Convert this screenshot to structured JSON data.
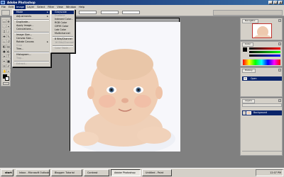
{
  "window": {
    "title": "Adobe Photoshop",
    "minimize": "_",
    "maximize": "□",
    "close": "×"
  },
  "menubar": {
    "items": [
      "File",
      "Edit",
      "Image",
      "Layer",
      "Select",
      "Filter",
      "View",
      "Window",
      "Help"
    ]
  },
  "image_menu": {
    "items": [
      {
        "label": "Mode",
        "state": "highlighted",
        "submenu": true
      },
      {
        "label": "Adjustments",
        "state": "normal",
        "submenu": true
      },
      {
        "label": "Duplicate...",
        "state": "normal"
      },
      {
        "label": "Apply Image...",
        "state": "normal"
      },
      {
        "label": "Calculations...",
        "state": "normal"
      },
      {
        "label": "Image Size...",
        "state": "normal"
      },
      {
        "label": "Canvas Size...",
        "state": "normal"
      },
      {
        "label": "Rotate Canvas",
        "state": "normal",
        "submenu": true
      },
      {
        "label": "Crop",
        "state": "disabled"
      },
      {
        "label": "Trim...",
        "state": "normal"
      },
      {
        "label": "Histogram...",
        "state": "normal"
      },
      {
        "label": "Trap...",
        "state": "disabled"
      },
      {
        "label": "Extract...",
        "state": "disabled"
      },
      {
        "label": "Liquify...",
        "state": "normal"
      }
    ]
  },
  "mode_submenu": {
    "items": [
      {
        "label": "Grayscale",
        "state": "highlighted"
      },
      {
        "label": "Duotone",
        "state": "disabled"
      },
      {
        "label": "Indexed Color...",
        "state": "normal"
      },
      {
        "label": "RGB Color",
        "state": "normal"
      },
      {
        "label": "CMYK Color",
        "state": "normal"
      },
      {
        "label": "Lab Color",
        "state": "normal"
      },
      {
        "label": "Multichannel",
        "state": "normal"
      },
      {
        "label": "8 Bits/Channel",
        "state": "normal"
      },
      {
        "label": "16 Bits/Channel",
        "state": "disabled"
      },
      {
        "label": "Color Table...",
        "state": "disabled"
      }
    ]
  },
  "panels": {
    "navigator_tab": "Navigator",
    "color_tab": "Color",
    "history_tab": "History",
    "history_item": "Open",
    "layers_tab": "Layers",
    "layer_name": "Background"
  },
  "taskbar": {
    "start": "start",
    "tasks": [
      {
        "label": "Inbox - Microsoft Outlook",
        "active": false
      },
      {
        "label": "Blogger: Tutorial",
        "active": false
      },
      {
        "label": "Contrast",
        "active": false
      },
      {
        "label": "Adobe Photoshop",
        "active": true
      },
      {
        "label": "Untitled - Paint",
        "active": false
      }
    ],
    "clock": "12:07 PM"
  },
  "colors": {
    "titlebar": "#0a246a",
    "menu": "#d4d0c8",
    "workspace": "#808080",
    "highlight": "#0a246a"
  }
}
